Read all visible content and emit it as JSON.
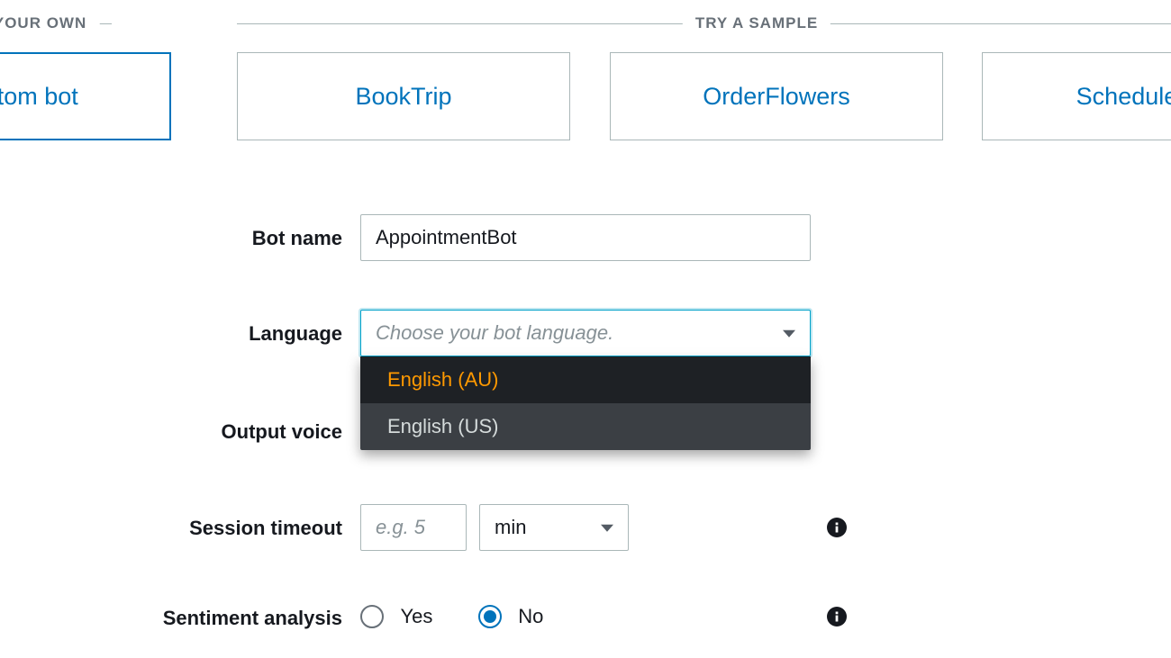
{
  "sections": {
    "create_label": "TE YOUR OWN",
    "sample_label": "TRY A SAMPLE"
  },
  "cards": {
    "custom": "stom bot",
    "booktrip": "BookTrip",
    "flowers": "OrderFlowers",
    "sched": "ScheduleApp"
  },
  "form": {
    "bot_name_label": "Bot name",
    "bot_name_value": "AppointmentBot",
    "language_label": "Language",
    "language_placeholder": "Choose your bot language.",
    "language_options": {
      "au": "English (AU)",
      "us": "English (US)"
    },
    "output_voice_label": "Output voice",
    "timeout_label": "Session timeout",
    "timeout_placeholder": "e.g. 5",
    "timeout_unit": "min",
    "sentiment_label": "Sentiment analysis",
    "yes": "Yes",
    "no": "No",
    "sentiment_value": "no"
  }
}
